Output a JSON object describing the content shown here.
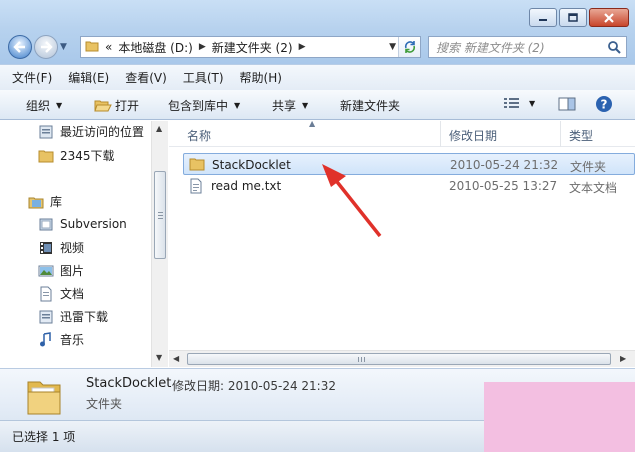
{
  "window": {
    "controls": [
      "minimize",
      "maximize",
      "close"
    ]
  },
  "nav": {
    "back_icon": "back-arrow-icon",
    "forward_icon": "forward-arrow-icon"
  },
  "address": {
    "overflow": "«",
    "crumbs": [
      "本地磁盘 (D:)",
      "新建文件夹 (2)"
    ],
    "refresh_icon": "refresh-icon"
  },
  "search": {
    "placeholder": "搜索 新建文件夹 (2)"
  },
  "menu": {
    "items": [
      "文件(F)",
      "编辑(E)",
      "查看(V)",
      "工具(T)",
      "帮助(H)"
    ]
  },
  "commands": {
    "organize": "组织",
    "open": "打开",
    "include_library": "包含到库中",
    "share": "共享",
    "new_folder": "新建文件夹"
  },
  "sidebar": {
    "items": [
      {
        "label": "最近访问的位置",
        "icon": "recent-places-icon"
      },
      {
        "label": "2345下载",
        "icon": "folder-icon"
      },
      {
        "label": "库",
        "icon": "libraries-icon"
      },
      {
        "label": "Subversion",
        "icon": "library-icon"
      },
      {
        "label": "视频",
        "icon": "video-icon"
      },
      {
        "label": "图片",
        "icon": "pictures-icon"
      },
      {
        "label": "文档",
        "icon": "documents-icon"
      },
      {
        "label": "迅雷下载",
        "icon": "download-icon"
      },
      {
        "label": "音乐",
        "icon": "music-icon"
      }
    ]
  },
  "columns": {
    "name": "名称",
    "modified": "修改日期",
    "type": "类型"
  },
  "files": [
    {
      "name": "StackDocklet",
      "modified": "2010-05-24 21:32",
      "type": "文件夹",
      "selected": true,
      "icon": "folder-icon"
    },
    {
      "name": "read me.txt",
      "modified": "2010-05-25 13:27",
      "type": "文本文档",
      "selected": false,
      "icon": "text-file-icon"
    }
  ],
  "details": {
    "name": "StackDocklet",
    "meta": "修改日期: 2010-05-24 21:32",
    "type": "文件夹"
  },
  "status": {
    "text": "已选择 1 项"
  },
  "colors": {
    "accent": "#3d7fd1",
    "arrow": "#e0312a",
    "watermark": "#f3bfe1"
  }
}
